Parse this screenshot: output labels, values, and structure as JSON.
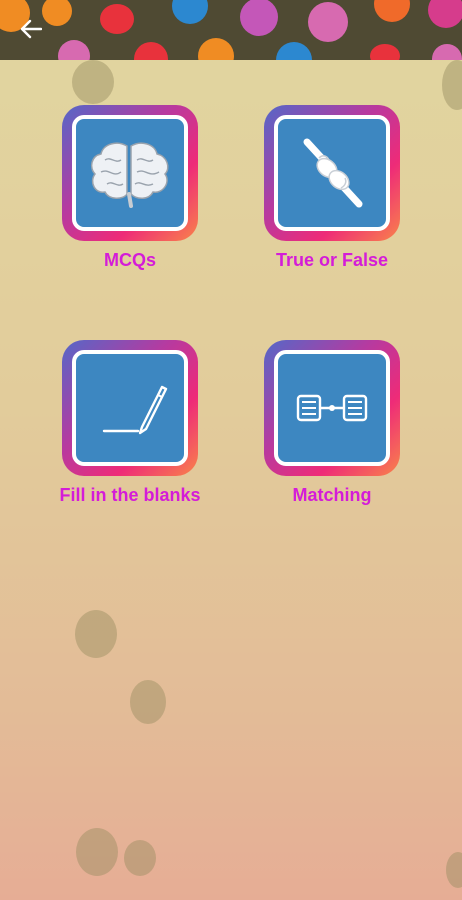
{
  "tiles": [
    {
      "label": "MCQs",
      "icon": "brain-icon"
    },
    {
      "label": "True or False",
      "icon": "pointing-fingers-icon"
    },
    {
      "label": "Fill in the blanks",
      "icon": "pen-icon"
    },
    {
      "label": "Matching",
      "icon": "matching-lists-icon"
    }
  ],
  "colors": {
    "tile_inner": "#3d87c1",
    "label": "#d41cd8",
    "topbar": "#4f4a33"
  }
}
